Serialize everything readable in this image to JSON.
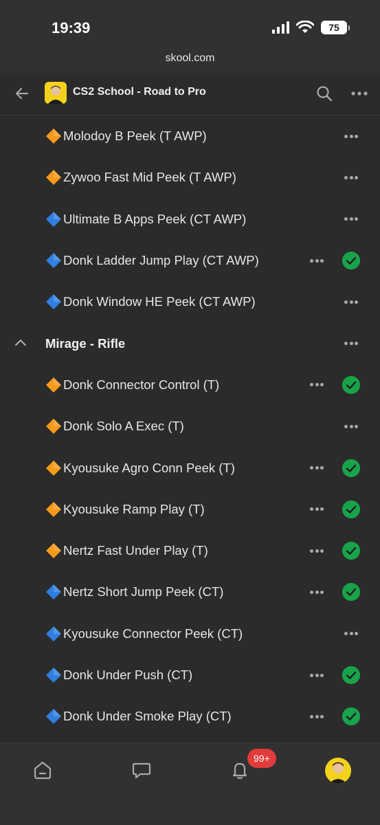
{
  "status_bar": {
    "time": "19:39",
    "battery": "75",
    "icons": [
      "signal-icon",
      "wifi-icon",
      "battery-icon"
    ]
  },
  "browser": {
    "url": "skool.com"
  },
  "header": {
    "title": "CS2 School - Road to Pro",
    "icons": [
      "back-arrow-icon",
      "group-avatar",
      "search-icon",
      "more-icon"
    ]
  },
  "colors": {
    "background": "#2b2b2b",
    "bar": "#313131",
    "text": "#e6e6e6",
    "check": "#18a34a",
    "diamond_orange": "#f59a1b",
    "diamond_blue": "#2f7fe0",
    "badge": "#e23b3b",
    "avatar": "#f2d21c"
  },
  "lessons_top": [
    {
      "label": "Molodoy B Peek (T AWP)",
      "side": "T",
      "completed": false
    },
    {
      "label": "Zywoo Fast Mid Peek (T AWP)",
      "side": "T",
      "completed": false
    },
    {
      "label": "Ultimate B Apps Peek (CT AWP)",
      "side": "CT",
      "completed": false
    },
    {
      "label": "Donk Ladder Jump Play (CT AWP)",
      "side": "CT",
      "completed": true
    },
    {
      "label": "Donk Window HE Peek (CT AWP)",
      "side": "CT",
      "completed": false
    }
  ],
  "section": {
    "title": "Mirage - Rifle",
    "expanded": true
  },
  "lessons_section": [
    {
      "label": "Donk Connector Control (T)",
      "side": "T",
      "completed": true
    },
    {
      "label": "Donk Solo A Exec (T)",
      "side": "T",
      "completed": false
    },
    {
      "label": "Kyousuke Agro Conn Peek (T)",
      "side": "T",
      "completed": true
    },
    {
      "label": "Kyousuke Ramp Play (T)",
      "side": "T",
      "completed": true
    },
    {
      "label": "Nertz Fast Under Play (T)",
      "side": "T",
      "completed": true
    },
    {
      "label": "Nertz Short Jump Peek (CT)",
      "side": "CT",
      "completed": true
    },
    {
      "label": "Kyousuke Connector Peek (CT)",
      "side": "CT",
      "completed": false
    },
    {
      "label": "Donk Under Push (CT)",
      "side": "CT",
      "completed": true
    },
    {
      "label": "Donk Under Smoke Play (CT)",
      "side": "CT",
      "completed": true
    }
  ],
  "bottom_nav": {
    "notifications_badge": "99+",
    "icons": [
      "home-icon",
      "chat-icon",
      "bell-icon",
      "profile-avatar"
    ]
  }
}
